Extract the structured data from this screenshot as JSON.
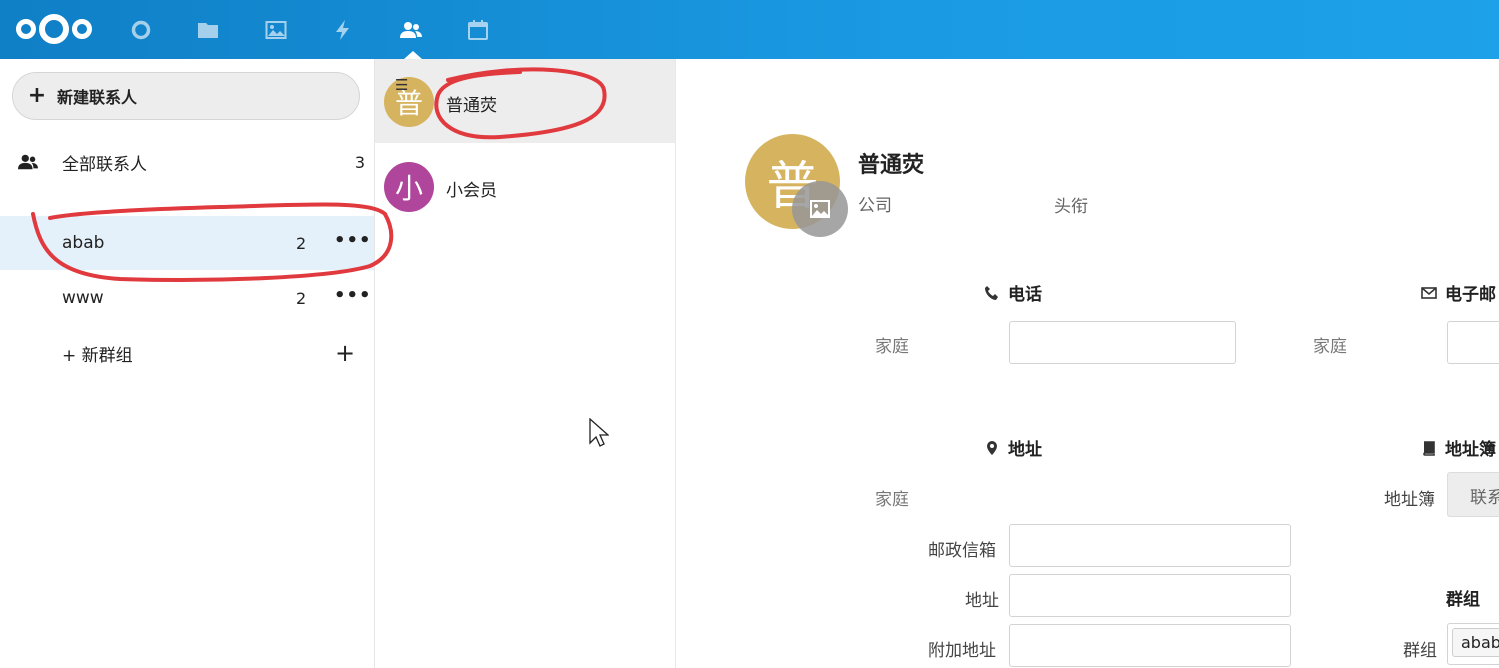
{
  "topbar": {
    "apps": [
      {
        "name": "dashboard-icon"
      },
      {
        "name": "files-icon"
      },
      {
        "name": "photos-icon"
      },
      {
        "name": "activity-icon"
      },
      {
        "name": "contacts-icon",
        "active": true
      },
      {
        "name": "calendar-icon"
      }
    ]
  },
  "sidebar": {
    "new_contact": "新建联系人",
    "all_contacts": {
      "label": "全部联系人",
      "count": "3"
    },
    "groups": [
      {
        "label": "abab",
        "count": "2",
        "more": "•••"
      },
      {
        "label": "www",
        "count": "2",
        "more": "•••"
      }
    ],
    "new_group": {
      "label": "+ 新群组",
      "add": "+"
    }
  },
  "contacts": [
    {
      "initial": "普",
      "name": "普通荧",
      "color": "#d6b35e"
    },
    {
      "initial": "小",
      "name": "小会员",
      "color": "#b0459c"
    }
  ],
  "detail": {
    "initial": "普",
    "name": "普通荧",
    "company_placeholder": "公司",
    "title_placeholder": "头衔",
    "phone": {
      "title": "电话",
      "type": "家庭"
    },
    "email": {
      "title": "电子邮",
      "type": "家庭"
    },
    "address": {
      "title": "地址",
      "type": "家庭",
      "po_box": "邮政信箱",
      "street": "地址",
      "extended": "附加地址"
    },
    "addressbook": {
      "title": "地址簿",
      "label": "地址簿",
      "value": "联系"
    },
    "groups": {
      "title": "群组",
      "label": "群组",
      "chip": "abab"
    }
  },
  "colors": {
    "topbar": "#1a9ae3",
    "annotation": "#e0393e",
    "avatar_primary": "#d6b35e",
    "avatar_secondary": "#b0459c"
  }
}
